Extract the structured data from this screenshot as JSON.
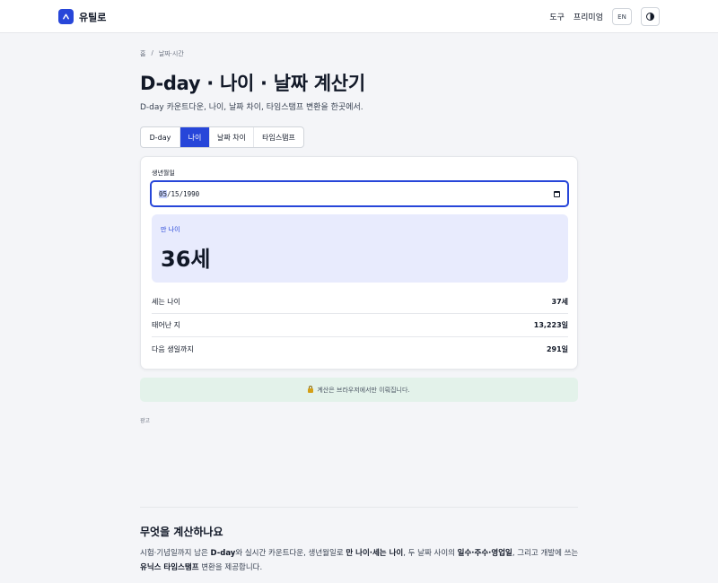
{
  "header": {
    "brand": "유틸로",
    "nav": [
      "도구",
      "프리미엄"
    ],
    "lang": "EN",
    "theme_icon": "half-circle-icon"
  },
  "breadcrumb": [
    "홈",
    "/",
    "날짜·시간"
  ],
  "page": {
    "title": "D-day · 나이 · 날짜 계산기",
    "subtitle": "D-day 카운트다운, 나이, 날짜 차이, 타임스탬프 변환을 한곳에서."
  },
  "tabs": [
    {
      "label": "D-day",
      "active": false
    },
    {
      "label": "나이",
      "active": true
    },
    {
      "label": "날짜 차이",
      "active": false
    },
    {
      "label": "타임스탬프",
      "active": false
    }
  ],
  "calculator": {
    "field_label": "생년월일",
    "date_month": "05",
    "date_rest": "/15/1990",
    "result_label": "만 나이",
    "result_value": "36세",
    "rows": [
      {
        "label": "세는 나이",
        "value": "37세"
      },
      {
        "label": "태어난 지",
        "value": "13,223일"
      },
      {
        "label": "다음 생일까지",
        "value": "291일"
      }
    ]
  },
  "notice": "계산은 브라우저에서만 이뤄집니다.",
  "ad_label": "광고",
  "about": {
    "title": "무엇을 계산하나요",
    "body_parts": [
      {
        "t": "시험·기념일까지 남은 ",
        "b": false
      },
      {
        "t": "D-day",
        "b": true
      },
      {
        "t": "와 실시간 카운트다운, 생년월일로 ",
        "b": false
      },
      {
        "t": "만 나이·세는 나이",
        "b": true
      },
      {
        "t": ", 두 날짜 사이의 ",
        "b": false
      },
      {
        "t": "일수·주수·영업일",
        "b": true
      },
      {
        "t": ", 그리고 개발에 쓰는 ",
        "b": false
      },
      {
        "t": "유닉스 타임스탬프",
        "b": true
      },
      {
        "t": " 변환을 제공합니다.",
        "b": false
      }
    ]
  },
  "colors": {
    "accent": "#2746d9",
    "result_bg": "#e8ebfd",
    "notice_bg": "#e3f2ea"
  }
}
